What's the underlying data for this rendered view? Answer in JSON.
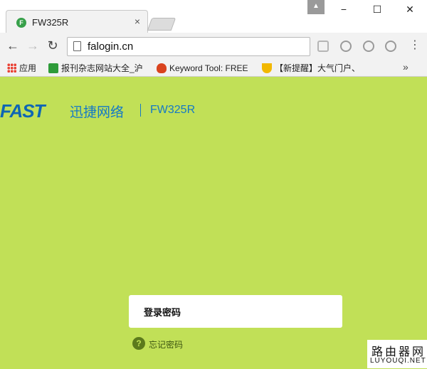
{
  "browser": {
    "tab_title": "FW325R",
    "tab_favicon": "F",
    "tab_close": "×",
    "url": "falogin.cn",
    "window_controls": {
      "minimize": "−",
      "maximize": "☐",
      "close": "✕"
    },
    "nav": {
      "back": "←",
      "forward": "→",
      "reload": "↻"
    },
    "menu": "⋮",
    "extension_icons": [
      "feather-icon",
      "shield-icon",
      "circle-ext-icon",
      "circle-ext-icon"
    ]
  },
  "bookmarks": {
    "items": [
      {
        "label": "应用",
        "icon": "apps-icon"
      },
      {
        "label": "报刊杂志网站大全_沪",
        "icon": "bookmark-green-icon"
      },
      {
        "label": "Keyword Tool: FREE",
        "icon": "flame-icon"
      },
      {
        "label": "【新提醒】大气门户、",
        "icon": "trophy-icon"
      }
    ],
    "overflow": "»"
  },
  "page": {
    "logo": "FAST",
    "brand": "迅捷网络",
    "model": "FW325R",
    "password_placeholder": "登录密码",
    "forgot_password": "忘记密码",
    "forgot_icon": "?",
    "colors": {
      "background": "#c1e057",
      "brand_blue": "#1479c6"
    }
  },
  "watermark": {
    "cn": "路由器网",
    "en": "LUYOUQI.NET"
  }
}
